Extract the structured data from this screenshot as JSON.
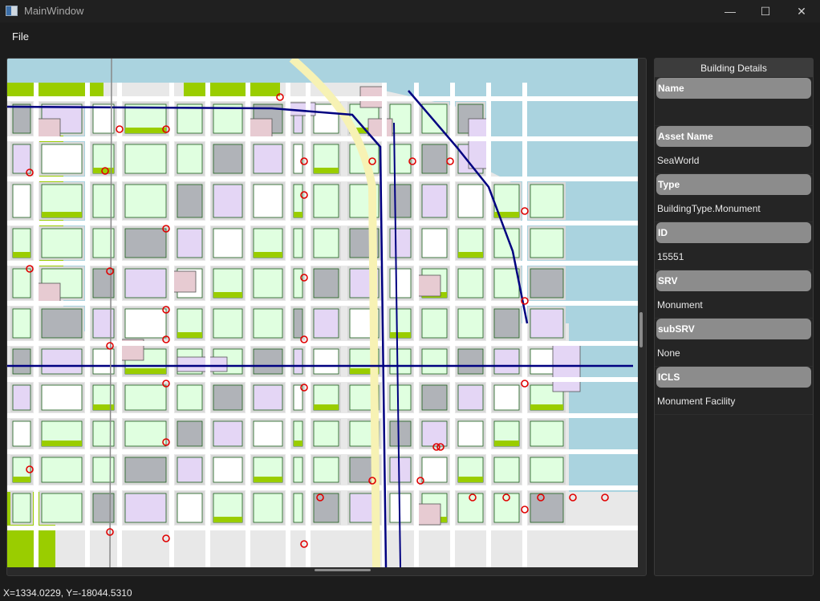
{
  "window": {
    "title": "MainWindow",
    "minimize": "—",
    "maximize": "☐",
    "close": "✕"
  },
  "menu": {
    "file": "File"
  },
  "details": {
    "header": "Building Details",
    "fields": [
      {
        "label": "Name",
        "value": ""
      },
      {
        "label": "Asset Name",
        "value": "SeaWorld"
      },
      {
        "label": "Type",
        "value": "BuildingType.Monument"
      },
      {
        "label": "ID",
        "value": "15551"
      },
      {
        "label": "SRV",
        "value": "Monument"
      },
      {
        "label": "subSRV",
        "value": "None"
      },
      {
        "label": "ICLS",
        "value": "Monument Facility"
      }
    ]
  },
  "status": {
    "coords": "X=1334.0229, Y=-18044.5310"
  },
  "map": {
    "colors": {
      "water": "#aad3df",
      "park": "#9acd00",
      "block": "#d9d9d9",
      "building": "#e0ffe0",
      "gray_building": "#b0b3b8",
      "purple_building": "#e4d6f5",
      "pink_building": "#e7cbd2",
      "road": "#ffffff",
      "rail": "#000080",
      "marker": "#e00000"
    }
  }
}
